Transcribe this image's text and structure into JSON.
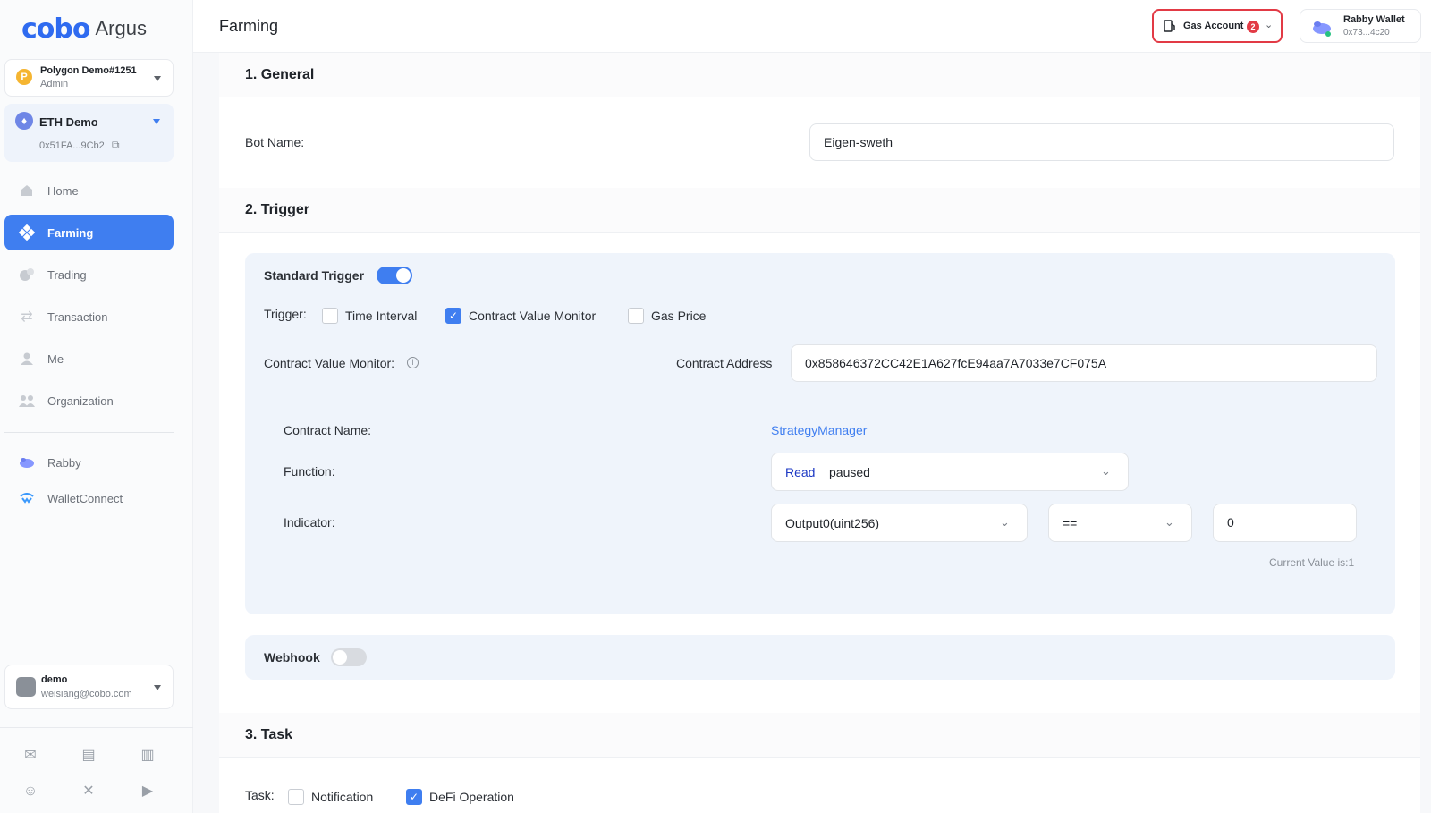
{
  "app": {
    "brand": "cobo",
    "product": "Argus"
  },
  "org": {
    "avatar_letter": "P",
    "name": "Polygon Demo#1251",
    "role": "Admin"
  },
  "account": {
    "name": "ETH Demo",
    "address": "0x51FA...9Cb2"
  },
  "nav": [
    {
      "label": "Home",
      "icon": "home-icon"
    },
    {
      "label": "Farming",
      "icon": "farming-icon"
    },
    {
      "label": "Trading",
      "icon": "trading-icon"
    },
    {
      "label": "Transaction",
      "icon": "transfer-icon"
    },
    {
      "label": "Me",
      "icon": "user-icon"
    },
    {
      "label": "Organization",
      "icon": "team-icon"
    }
  ],
  "connect": [
    {
      "label": "Rabby",
      "icon": "rabby-icon"
    },
    {
      "label": "WalletConnect",
      "icon": "walletconnect-icon"
    }
  ],
  "user": {
    "name": "demo",
    "email": "weisiang@cobo.com"
  },
  "footer_icons": [
    "mail-icon",
    "book-icon",
    "map-icon",
    "discord-icon",
    "x-icon",
    "youtube-icon"
  ],
  "header": {
    "title": "Farming",
    "gas_account": {
      "label": "Gas Account",
      "badge": "2"
    },
    "wallet": {
      "name": "Rabby Wallet",
      "address": "0x73...4c20"
    }
  },
  "general": {
    "title": "1. General",
    "bot_name_label": "Bot Name:",
    "bot_name_value": "Eigen-sweth"
  },
  "trigger": {
    "title": "2. Trigger",
    "standard_label": "Standard Trigger",
    "standard_on": true,
    "trigger_label": "Trigger:",
    "options": [
      {
        "label": "Time Interval",
        "checked": false
      },
      {
        "label": "Contract Value Monitor",
        "checked": true
      },
      {
        "label": "Gas Price",
        "checked": false
      }
    ],
    "cvm_label": "Contract Value Monitor:",
    "contract_address_label": "Contract Address",
    "contract_address": "0x858646372CC42E1A627fcE94aa7A7033e7CF075A",
    "contract_name_label": "Contract Name:",
    "contract_name": "StrategyManager",
    "function_label": "Function:",
    "function_type": "Read",
    "function_name": "paused",
    "indicator_label": "Indicator:",
    "indicator_output": "Output0(uint256)",
    "indicator_operator": "==",
    "indicator_value": "0",
    "current_value": "Current Value is:1",
    "webhook_label": "Webhook",
    "webhook_on": false
  },
  "task": {
    "title": "3. Task",
    "label": "Task:",
    "options": [
      {
        "label": "Notification",
        "checked": false
      },
      {
        "label": "DeFi Operation",
        "checked": true
      }
    ]
  },
  "colors": {
    "accent": "#3f7ef0",
    "danger": "#e23a45",
    "panel": "#eff4fb"
  }
}
